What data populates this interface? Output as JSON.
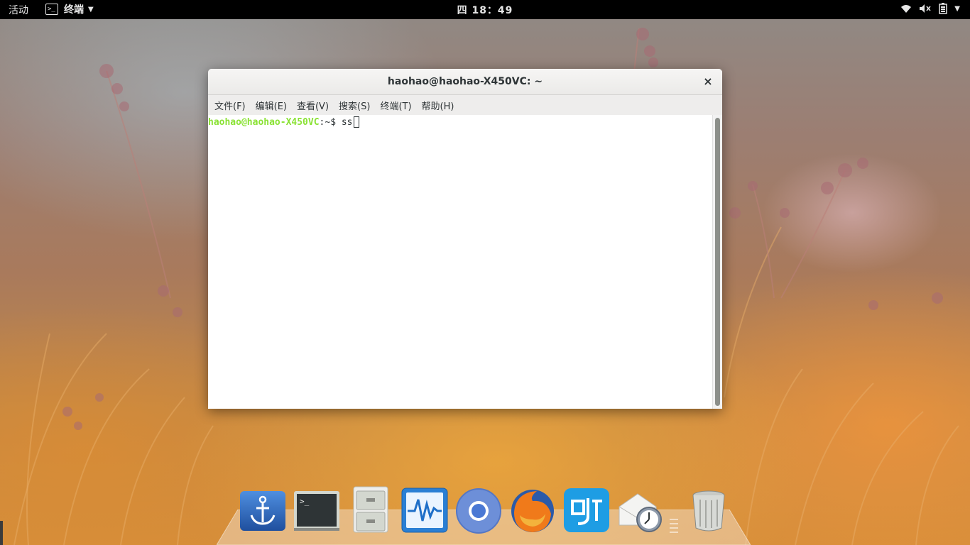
{
  "top_panel": {
    "activities": "活动",
    "app_name": "终端",
    "clock": "四 18：49"
  },
  "terminal": {
    "title": "haohao@haohao-X450VC: ~",
    "close_glyph": "×",
    "menu": [
      "文件(F)",
      "编辑(E)",
      "查看(V)",
      "搜索(S)",
      "终端(T)",
      "帮助(H)"
    ],
    "prompt_user_host": "haohao@haohao-X450VC",
    "prompt_path": ":~$ ",
    "command": "ss"
  },
  "dock": {
    "items": [
      {
        "icon": "anchor-icon",
        "app": "anchor"
      },
      {
        "icon": "terminal-icon",
        "app": "terminal"
      },
      {
        "icon": "file-cabinet-icon",
        "app": "files"
      },
      {
        "icon": "system-monitor-icon",
        "app": "system monitor"
      },
      {
        "icon": "chromium-icon",
        "app": "chromium"
      },
      {
        "icon": "firefox-icon",
        "app": "firefox"
      },
      {
        "icon": "ime-icon",
        "app": "input method"
      },
      {
        "icon": "mail-clock-icon",
        "app": "mail scheduler"
      },
      {
        "icon": "trash-icon",
        "app": "trash"
      }
    ]
  },
  "colors": {
    "panel_bg": "#000000",
    "prompt_green": "#8ae234",
    "terminal_text": "#2e3436"
  }
}
